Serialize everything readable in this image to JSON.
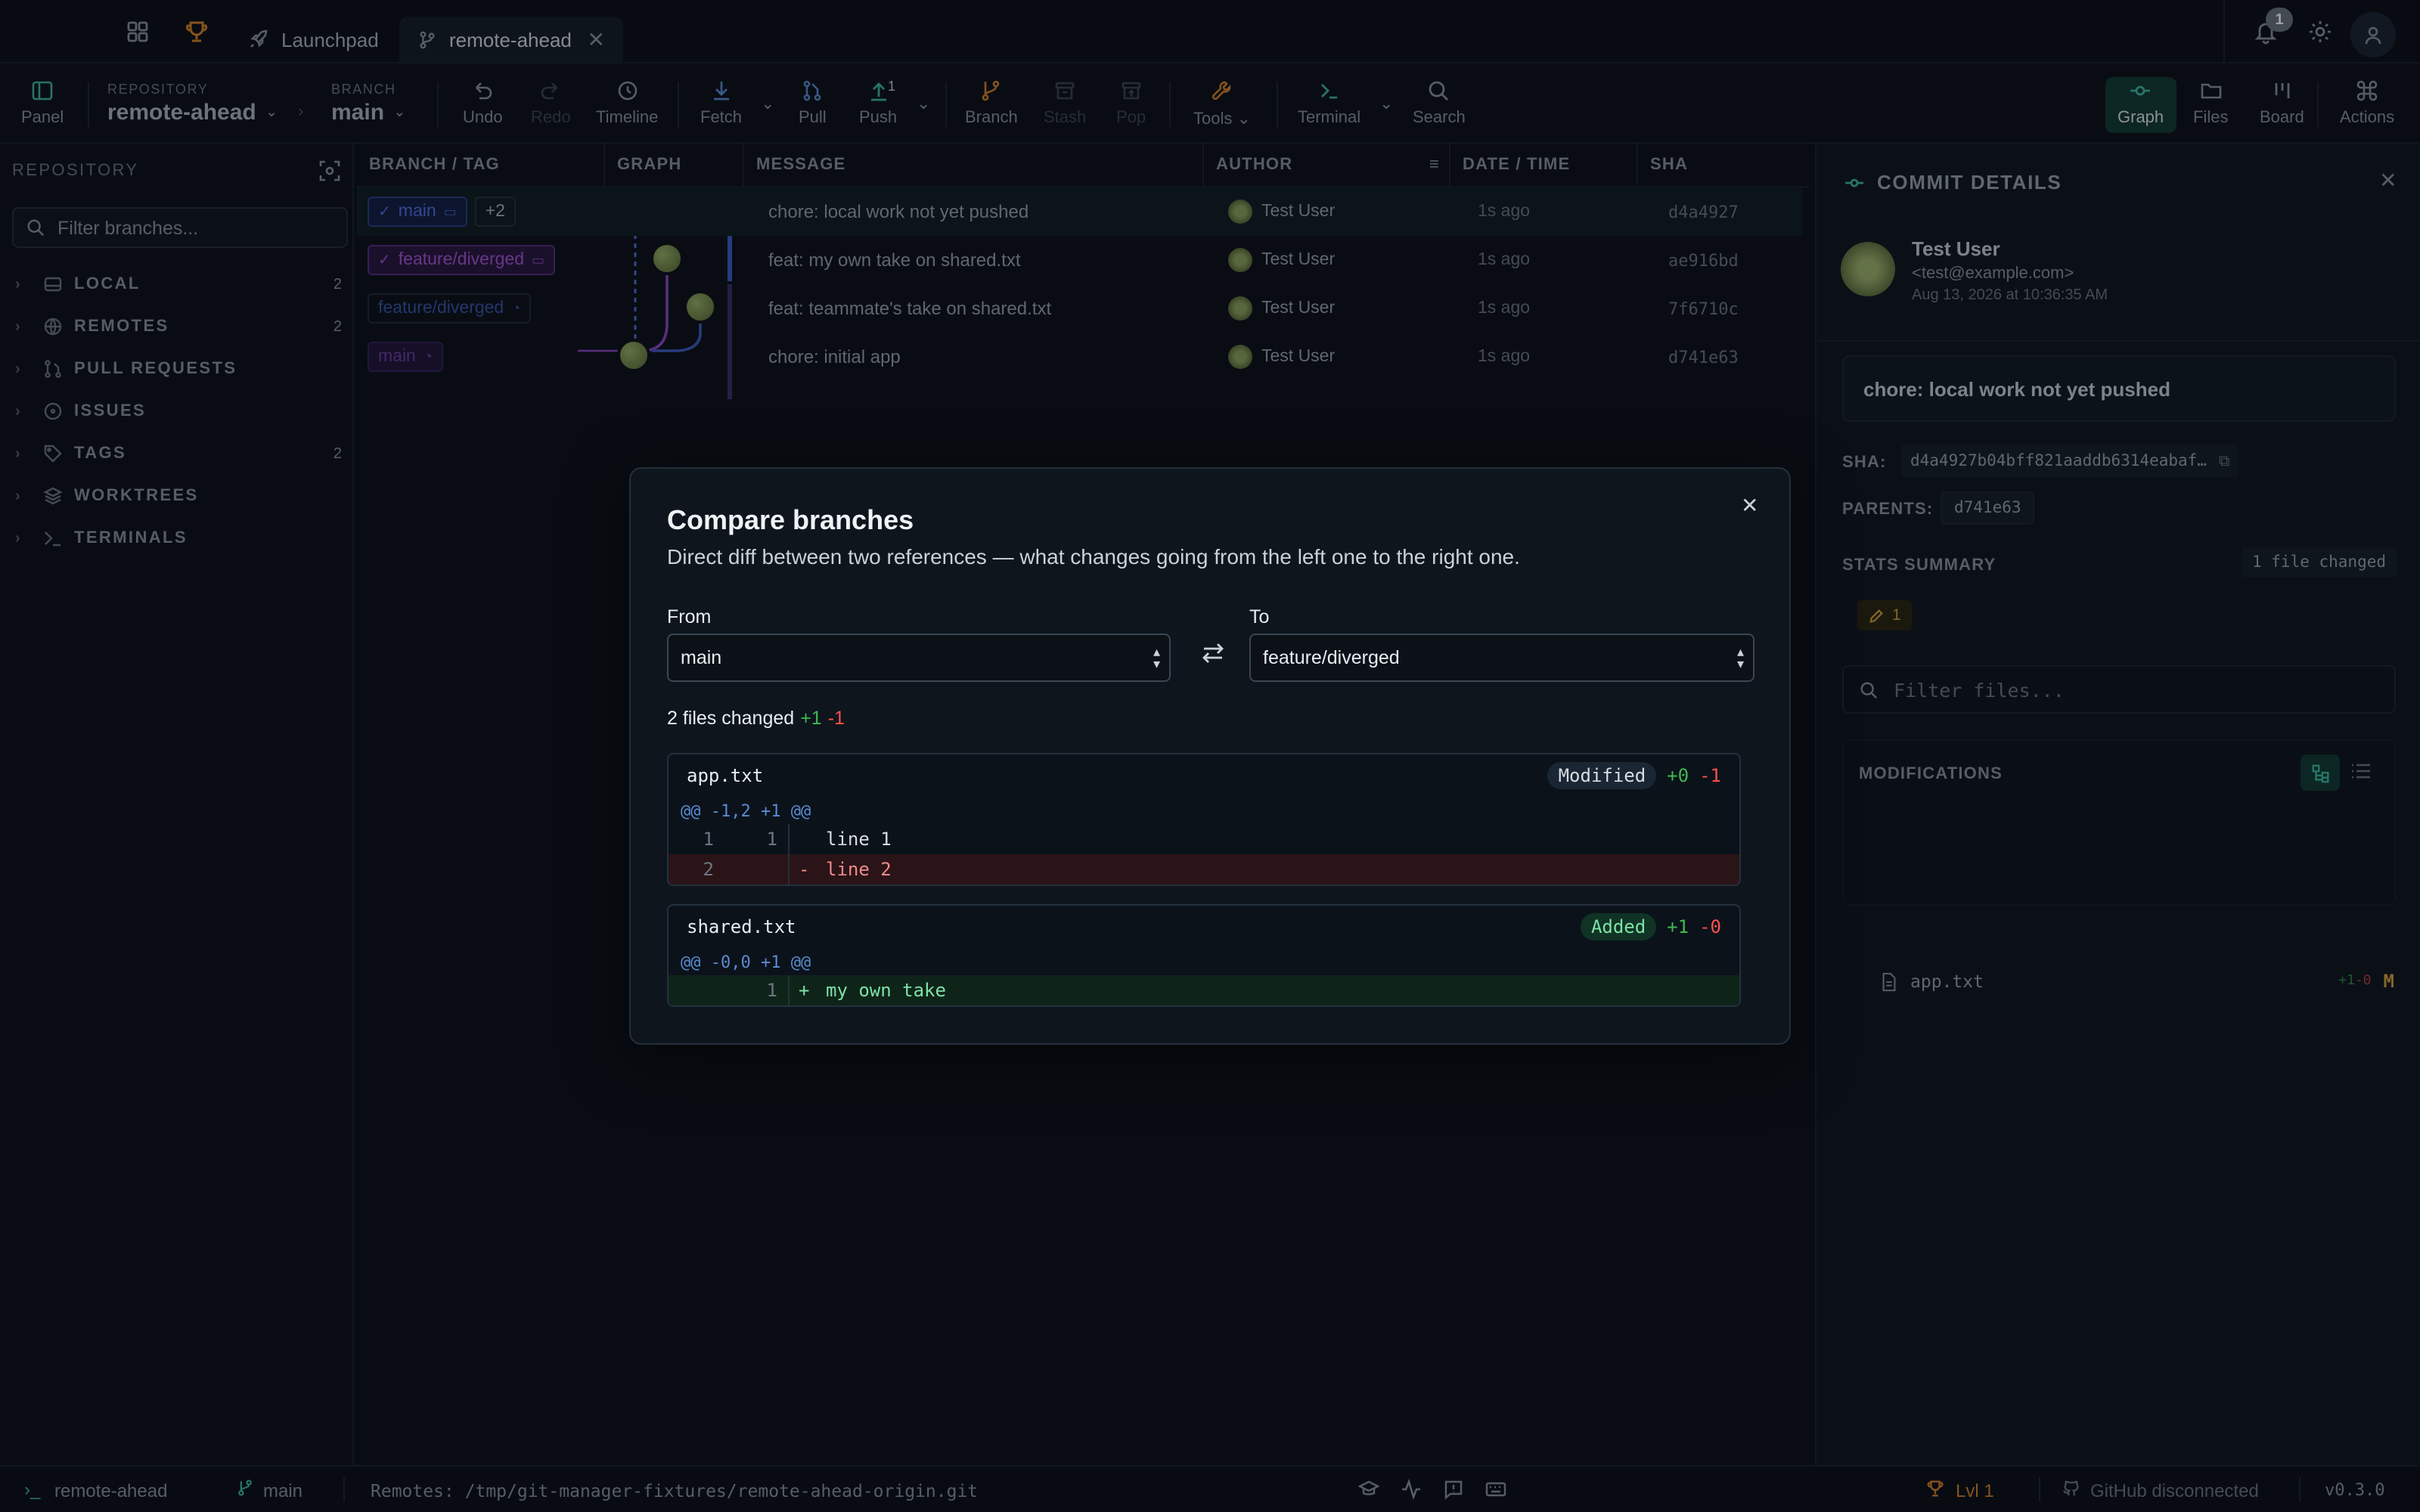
{
  "tabs": {
    "launchpad": "Launchpad",
    "repo": "remote-ahead",
    "notif_count": "1"
  },
  "toolbar": {
    "panel": "Panel",
    "repo_label": "REPOSITORY",
    "repo_name": "remote-ahead",
    "branch_label": "BRANCH",
    "branch_name": "main",
    "undo": "Undo",
    "redo": "Redo",
    "timeline": "Timeline",
    "fetch": "Fetch",
    "pull": "Pull",
    "push": "Push",
    "push_count": "1",
    "branch": "Branch",
    "stash": "Stash",
    "pop": "Pop",
    "tools": "Tools",
    "terminal": "Terminal",
    "search": "Search",
    "graph": "Graph",
    "files": "Files",
    "board": "Board",
    "actions": "Actions"
  },
  "sidebar": {
    "title": "REPOSITORY",
    "filter_placeholder": "Filter branches...",
    "items": [
      {
        "label": "LOCAL",
        "count": "2",
        "icon": "drive-icon"
      },
      {
        "label": "REMOTES",
        "count": "2",
        "icon": "globe-icon"
      },
      {
        "label": "PULL REQUESTS",
        "count": "",
        "icon": "pull-request-icon"
      },
      {
        "label": "ISSUES",
        "count": "",
        "icon": "issue-icon"
      },
      {
        "label": "TAGS",
        "count": "2",
        "icon": "tag-icon"
      },
      {
        "label": "WORKTREES",
        "count": "",
        "icon": "layers-icon"
      },
      {
        "label": "TERMINALS",
        "count": "",
        "icon": "terminal-icon"
      }
    ]
  },
  "graph": {
    "columns": [
      "BRANCH / TAG",
      "GRAPH",
      "MESSAGE",
      "AUTHOR",
      "DATE / TIME",
      "SHA"
    ],
    "rows": [
      {
        "ref": "main",
        "extra": "+2",
        "message": "chore: local work not yet pushed",
        "author": "Test User",
        "time": "1s ago",
        "sha": "d4a4927"
      },
      {
        "ref": "feature/diverged",
        "extra": "",
        "message": "feat: my own take on shared.txt",
        "author": "Test User",
        "time": "1s ago",
        "sha": "ae916bd"
      },
      {
        "ref": "feature/diverged",
        "extra": "",
        "message": "feat: teammate's take on shared.txt",
        "author": "Test User",
        "time": "1s ago",
        "sha": "7f6710c"
      },
      {
        "ref": "main",
        "extra": "",
        "message": "chore: initial app",
        "author": "Test User",
        "time": "1s ago",
        "sha": "d741e63"
      }
    ]
  },
  "details": {
    "title": "COMMIT DETAILS",
    "author": "Test User",
    "email": "<test@example.com>",
    "date": "Aug 13, 2026 at 10:36:35 AM",
    "message": "chore: local work not yet pushed",
    "sha_label": "SHA:",
    "sha": "d4a4927b04bff821aaddb6314eabaf…",
    "parents_label": "PARENTS:",
    "parent": "d741e63",
    "stats_label": "STATS SUMMARY",
    "files_changed": "1 file changed",
    "stat_count": "1",
    "filter_placeholder": "Filter files...",
    "mods_label": "MODIFICATIONS",
    "file": "app.txt",
    "file_plus": "+1",
    "file_minus": "-0",
    "file_status": "M"
  },
  "modal": {
    "title": "Compare branches",
    "subtitle": "Direct diff between two references — what changes going from the left one to the right one.",
    "from_label": "From",
    "from_value": "main",
    "to_label": "To",
    "to_value": "feature/diverged",
    "summary": "2 files changed",
    "summary_plus": "+1",
    "summary_minus": "-1",
    "files": [
      {
        "name": "app.txt",
        "status": "Modified",
        "plus": "+0",
        "minus": "-1",
        "hunk": "@@ -1,2 +1 @@",
        "lines": [
          {
            "old": "1",
            "new": "1",
            "sign": "",
            "text": "line 1"
          },
          {
            "old": "2",
            "new": "",
            "sign": "-",
            "text": "line 2"
          }
        ]
      },
      {
        "name": "shared.txt",
        "status": "Added",
        "plus": "+1",
        "minus": "-0",
        "hunk": "@@ -0,0 +1 @@",
        "lines": [
          {
            "old": "",
            "new": "1",
            "sign": "+",
            "text": "my own take"
          }
        ]
      }
    ]
  },
  "status": {
    "repo": "remote-ahead",
    "branch": "main",
    "remotes": "Remotes: /tmp/git-manager-fixtures/remote-ahead-origin.git",
    "level": "Lvl 1",
    "github": "GitHub disconnected",
    "version": "v0.3.0"
  },
  "colors": {
    "accent": "#3fb9a0",
    "add": "#3fb950",
    "del": "#f85149",
    "main_branch": "#4f6fe0",
    "feature_branch": "#a356d6"
  }
}
